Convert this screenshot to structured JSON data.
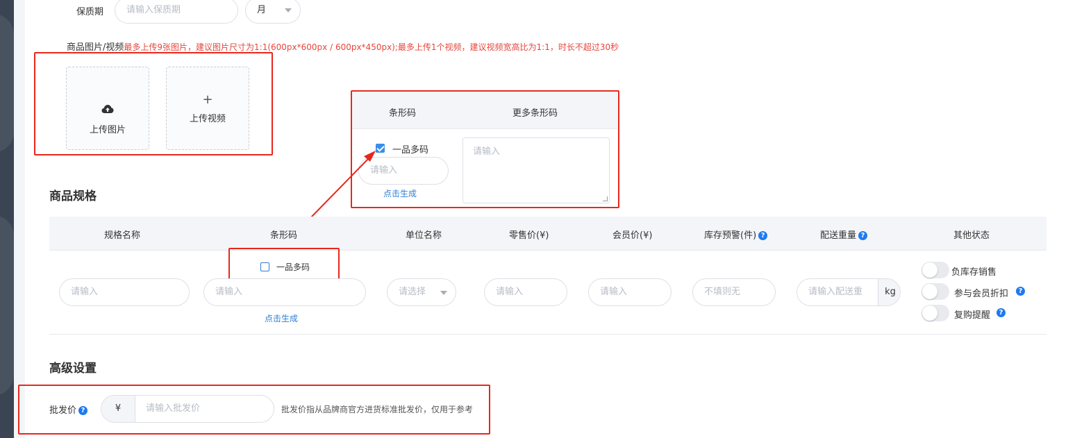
{
  "shelf_life": {
    "label": "保质期",
    "placeholder": "请输入保质期",
    "unit": "月"
  },
  "media": {
    "label": "商品图片/视频",
    "hint": "最多上传9张图片，建议图片尺寸为1:1(600px*600px / 600px*450px);最多上传1个视频，建议视频宽高比为1:1，时长不超过30秒",
    "upload_image": "上传图片",
    "upload_video": "上传视频"
  },
  "popup": {
    "col_barcode": "条形码",
    "col_more_barcodes": "更多条形码",
    "multi_code_label": "一品多码",
    "multi_code_checked": true,
    "input_placeholder": "请输入",
    "generate_link": "点击生成",
    "textarea_placeholder": "请输入"
  },
  "spec": {
    "title": "商品规格",
    "headers": {
      "name": "规格名称",
      "barcode": "条形码",
      "unit": "单位名称",
      "retail": "零售价(¥)",
      "member": "会员价(¥)",
      "stock_alert": "库存预警(件)",
      "weight": "配送重量",
      "status": "其他状态"
    },
    "row": {
      "name_placeholder": "请输入",
      "multi_code_label": "一品多码",
      "multi_code_checked": false,
      "barcode_placeholder": "请输入",
      "generate_link": "点击生成",
      "unit_placeholder": "请选择",
      "retail_placeholder": "请输入",
      "member_placeholder": "请输入",
      "stock_placeholder": "不填则无",
      "weight_placeholder": "请输入配送重",
      "weight_unit": "kg"
    },
    "toggles": [
      {
        "label": "负库存销售",
        "on": false,
        "help": false
      },
      {
        "label": "参与会员折扣",
        "on": false,
        "help": true
      },
      {
        "label": "复购提醒",
        "on": false,
        "help": true
      }
    ]
  },
  "advanced": {
    "title": "高级设置",
    "wholesale_label": "批发价",
    "currency": "¥",
    "wholesale_placeholder": "请输入批发价",
    "wholesale_hint": "批发价指从品牌商官方进货标准批发价，仅用于参考"
  },
  "colors": {
    "accent_blue": "#1d7af0",
    "annotation_red": "#e8271b",
    "hint_red": "#e8453c"
  }
}
